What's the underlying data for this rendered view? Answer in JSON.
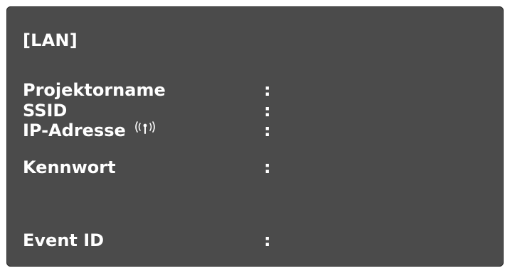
{
  "section_title": "[LAN]",
  "separator": ":",
  "rows": [
    {
      "label": "Projektorname",
      "value": ""
    },
    {
      "label": "SSID",
      "value": ""
    },
    {
      "label": "IP-Adresse",
      "value": "",
      "icon": "wifi-signal-icon"
    },
    {
      "label": "Kennwort",
      "value": ""
    },
    {
      "label": "Event ID",
      "value": ""
    }
  ],
  "colors": {
    "panel_background": "#4b4b4b",
    "text": "#ffffff",
    "page_background": "#ffffff"
  }
}
